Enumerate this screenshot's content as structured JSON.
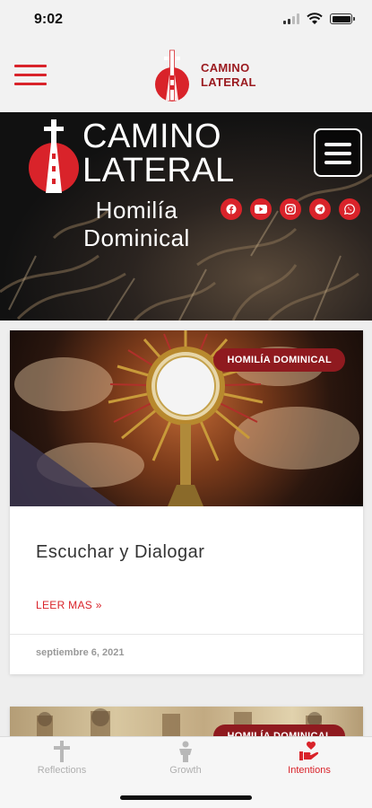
{
  "status_bar": {
    "time": "9:02"
  },
  "header": {
    "logo_line1": "CAMINO",
    "logo_line2": "LATERAL"
  },
  "banner": {
    "title_line1": "CAMINO",
    "title_line2": "LATERAL",
    "subtitle_line1": "Homilía",
    "subtitle_line2": "Dominical",
    "social_icons": [
      "facebook-icon",
      "youtube-icon",
      "instagram-icon",
      "telegram-icon",
      "whatsapp-icon"
    ]
  },
  "posts": [
    {
      "badge": "HOMILÍA DOMINICAL",
      "title": "Escuchar y Dialogar",
      "read_more": "LEER MAS »",
      "date": "septiembre 6, 2021"
    },
    {
      "badge": "HOMILÍA DOMINICAL"
    }
  ],
  "tabs": [
    {
      "label": "Reflections",
      "icon": "cross-icon",
      "active": false
    },
    {
      "label": "Growth",
      "icon": "person-growth-icon",
      "active": false
    },
    {
      "label": "Intentions",
      "icon": "heart-hand-icon",
      "active": true
    }
  ],
  "colors": {
    "accent": "#d9232a",
    "badge": "#8f1a1f",
    "brand_dark": "#9b1b20"
  }
}
